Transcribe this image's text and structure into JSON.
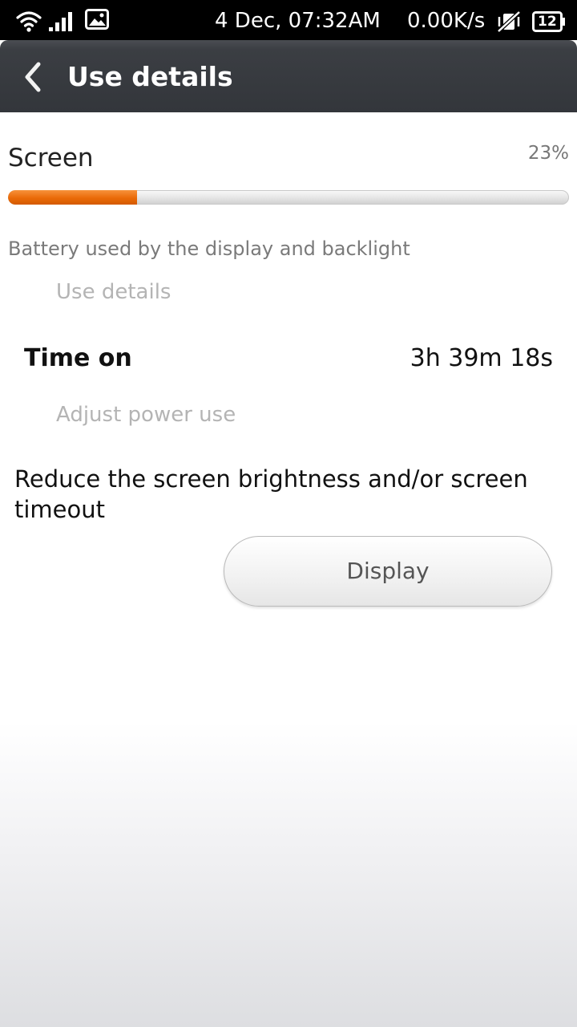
{
  "status_bar": {
    "datetime": "4 Dec, 07:32AM",
    "network_speed": "0.00K/s",
    "battery_level": "12",
    "icons": [
      "wifi-icon",
      "signal-icon",
      "gallery-notification-icon",
      "vibrate-off-icon",
      "battery-icon"
    ]
  },
  "action_bar": {
    "title": "Use details",
    "back_icon": "chevron-left-icon"
  },
  "screen": {
    "label": "Screen",
    "percent_text": "23%",
    "percent_value": 23,
    "description": "Battery used by the display and backlight"
  },
  "use_details": {
    "header": "Use details",
    "time_on_label": "Time on",
    "time_on_value": "3h 39m 18s"
  },
  "adjust": {
    "header": "Adjust power use",
    "tip": "Reduce the screen brightness and/or screen timeout",
    "button_label": "Display"
  },
  "colors": {
    "accent": "#ea6a08",
    "action_bar": "#35383d",
    "status_bar": "#000000"
  }
}
